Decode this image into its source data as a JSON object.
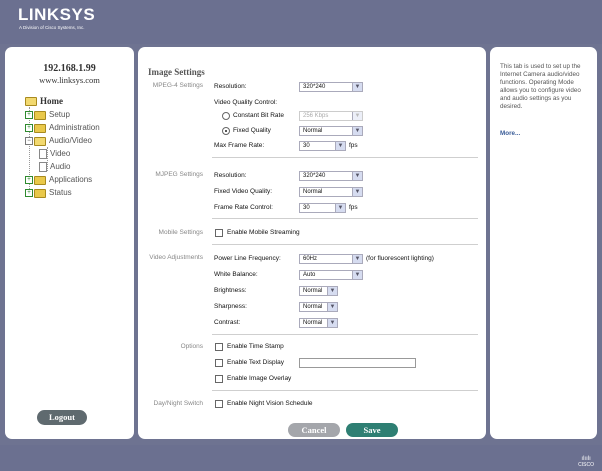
{
  "brand": {
    "logo": "LINKSYS",
    "subtitle": "A Division of Cisco Systems, Inc.",
    "footer_logo": "CISCO"
  },
  "device": {
    "ip": "192.168.1.99",
    "url": "www.linksys.com"
  },
  "nav": {
    "home": "Home",
    "items": [
      "Setup",
      "Administration",
      "Audio/Video",
      "Video",
      "Audio",
      "Applications",
      "Status"
    ]
  },
  "logout_label": "Logout",
  "page_title": "Image Settings",
  "mpeg4": {
    "section": "MPEG-4 Settings",
    "resolution_label": "Resolution:",
    "resolution_value": "320*240",
    "quality_control_label": "Video Quality Control:",
    "cbr_label": "Constant Bit Rate",
    "cbr_value": "256 Kbps",
    "fixed_label": "Fixed Quality",
    "fixed_value": "Normal",
    "max_frame_label": "Max Frame Rate:",
    "max_frame_value": "30",
    "fps": "fps"
  },
  "mjpeg": {
    "section": "MJPEG Settings",
    "resolution_label": "Resolution:",
    "resolution_value": "320*240",
    "quality_label": "Fixed Video Quality:",
    "quality_value": "Normal",
    "frame_label": "Frame Rate Control:",
    "frame_value": "30",
    "fps": "fps"
  },
  "mobile": {
    "section": "Mobile Settings",
    "enable_label": "Enable Mobile Streaming"
  },
  "video_adj": {
    "section": "Video Adjustments",
    "power_label": "Power Line Frequency:",
    "power_value": "60Hz",
    "power_note": "(for fluorescent lighting)",
    "wb_label": "White Balance:",
    "wb_value": "Auto",
    "brightness_label": "Brightness:",
    "brightness_value": "Normal",
    "sharpness_label": "Sharpness:",
    "sharpness_value": "Normal",
    "contrast_label": "Contrast:",
    "contrast_value": "Normal"
  },
  "options": {
    "section": "Options",
    "timestamp_label": "Enable Time Stamp",
    "text_label": "Enable Text Display",
    "overlay_label": "Enable Image Overlay"
  },
  "daynight": {
    "section": "Day/Night Switch",
    "schedule_label": "Enable Night Vision Schedule"
  },
  "buttons": {
    "cancel": "Cancel",
    "save": "Save"
  },
  "help": {
    "text": "This tab is used to set up the Internet Camera audio/video functions. Operating Mode allows you to configure video and audio settings as you desired.",
    "more": "More..."
  }
}
